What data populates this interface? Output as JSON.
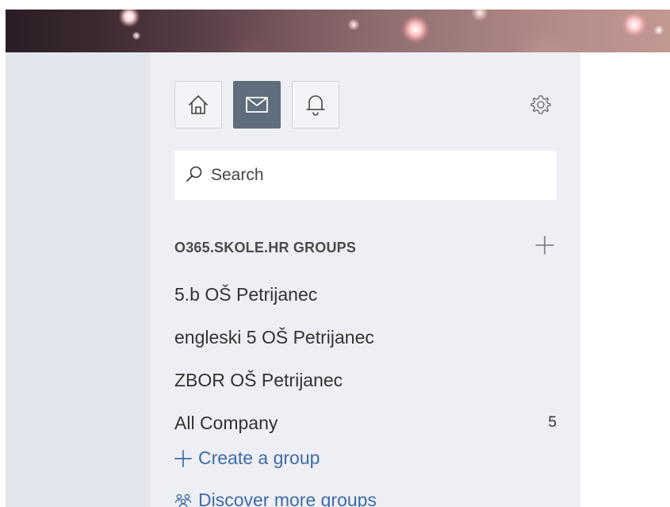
{
  "icons": {
    "home": "home-icon",
    "mail": "mail-icon",
    "notifications": "bell-icon",
    "settings": "gear-icon",
    "search": "search-icon",
    "add": "plus-icon",
    "discover": "people-icon"
  },
  "search": {
    "placeholder": "Search"
  },
  "groups_section": {
    "title": "O365.SKOLE.HR GROUPS",
    "items": [
      {
        "label": "5.b OŠ Petrijanec",
        "count": ""
      },
      {
        "label": "engleski 5 OŠ Petrijanec",
        "count": ""
      },
      {
        "label": "ZBOR OŠ Petrijanec",
        "count": ""
      },
      {
        "label": "All Company",
        "count": "5"
      }
    ],
    "create_label": "Create a group",
    "discover_label": "Discover more groups"
  },
  "colors": {
    "accent_link": "#3f6ba8",
    "active_tab": "#5f6e7d",
    "panel_bg": "#eeeff4",
    "rail_bg": "#e3e6ed"
  }
}
